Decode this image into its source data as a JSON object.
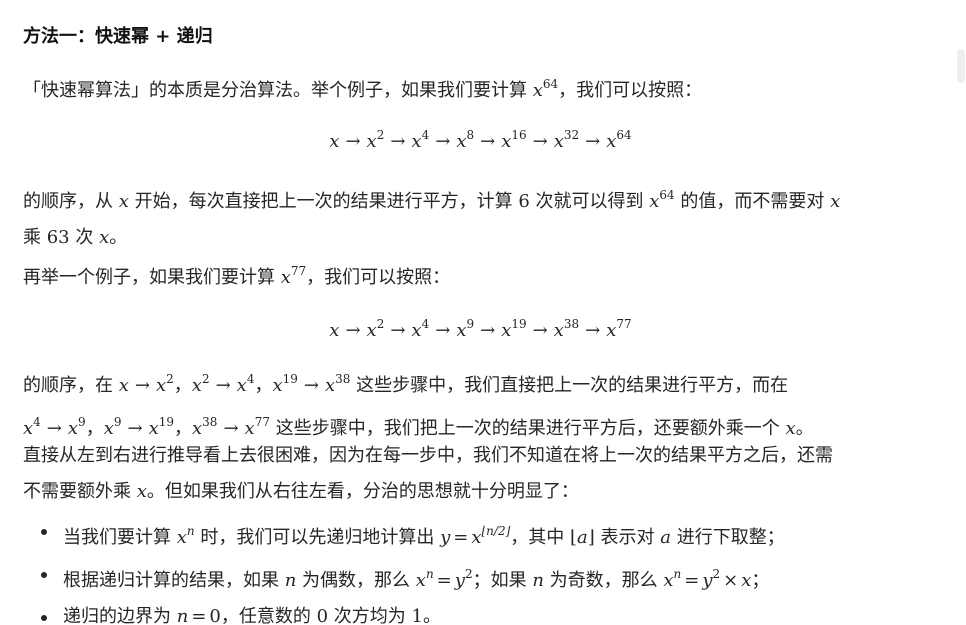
{
  "heading": "方法一：快速幂 + 递归",
  "p1": {
    "a": "「快速幂算法」的本质是分治算法。举个例子，如果我们要计算 ",
    "b": "，我们可以按照："
  },
  "p2": {
    "a": "的顺序，从 ",
    "b": " 开始，每次直接把上一次的结果进行平方，计算 ",
    "c": "6",
    "d": " 次就可以得到 ",
    "e": " 的值，而不需要对 ",
    "f": "乘 ",
    "g": "63",
    "h": " 次 ",
    "i": "。"
  },
  "p3": {
    "a": "再举一个例子，如果我们要计算 ",
    "b": "，我们可以按照："
  },
  "p4": {
    "a": "的顺序，在 ",
    "sep": "，",
    "b": " 这些步骤中，我们直接把上一次的结果进行平方，而在",
    "c": " 这些步骤中，我们把上一次的结果进行平方后，还要额外乘一个 ",
    "d": "。"
  },
  "p5": {
    "a": "直接从左到右进行推导看上去很困难，因为在每一步中，我们不知道在将上一次的结果平方之后，还需",
    "b": "不需要额外乘 ",
    "c": "。但如果我们从右往左看，分治的思想就十分明显了："
  },
  "list": {
    "i1": {
      "a": "当我们要计算 ",
      "b": " 时，我们可以先递归地计算出 ",
      "c": "，其中 ",
      "d": " 表示对 ",
      "e": " 进行下取整；"
    },
    "i2": {
      "a": "根据递归计算的结果，如果 ",
      "b": " 为偶数，那么 ",
      "c": "；如果 ",
      "d": " 为奇数，那么 ",
      "e": "；"
    },
    "i3": {
      "a": "递归的边界为 ",
      "b": "，任意数的 ",
      "c": "0",
      "d": " 次方均为 ",
      "e": "1",
      "f": "。"
    }
  },
  "math": {
    "x": "x",
    "a": "a",
    "n": "n",
    "y": "y",
    "arrow": "→",
    "eq": "=",
    "times": "×",
    "zero": "0",
    "exp_2": "2",
    "exp_4": "4",
    "exp_8": "8",
    "exp_9": "9",
    "exp_16": "16",
    "exp_19": "19",
    "exp_32": "32",
    "exp_38": "38",
    "exp_64": "64",
    "exp_77": "77",
    "floor_n2": "⌊n/2⌋",
    "floor_a_open": "⌊",
    "floor_a_close": "⌋"
  },
  "colors": {
    "text": "#262626",
    "heading": "#111111",
    "background": "#ffffff",
    "scrollbar_thumb": "#eeeeee"
  }
}
